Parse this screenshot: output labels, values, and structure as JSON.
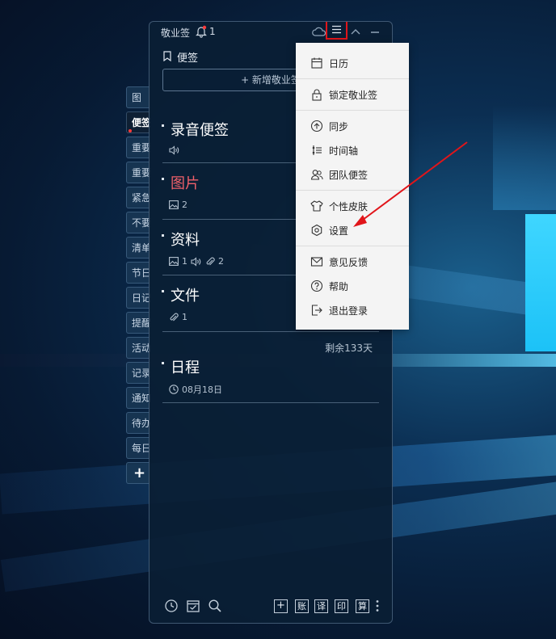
{
  "window": {
    "title": "敬业签",
    "notification_count": "1"
  },
  "section_title": "便签",
  "new_button_label": "+ 新增敬业签",
  "tabs": [
    "图",
    "便签",
    "重要",
    "重要",
    "紧急",
    "不要",
    "清单",
    "节日",
    "日记",
    "提醒",
    "活动",
    "记录",
    "通知",
    "待办",
    "每日"
  ],
  "tab_add_label": "+",
  "notes": [
    {
      "title": "录音便签",
      "audio": true
    },
    {
      "title": "图片",
      "image_count": "2"
    },
    {
      "title": "资料",
      "image_count": "1",
      "attachment_count": "2",
      "audio": true
    },
    {
      "title": "文件",
      "attachment_count": "1"
    },
    {
      "title": "日程",
      "date": "08月18日"
    }
  ],
  "remaining_days": "剩余133天",
  "menu": {
    "items": [
      "日历",
      "锁定敬业签",
      "同步",
      "时间轴",
      "团队便签",
      "个性皮肤",
      "设置",
      "意见反馈",
      "帮助",
      "退出登录"
    ]
  },
  "bottom_toolbar": {
    "buttons": [
      "账",
      "译",
      "印",
      "算"
    ]
  },
  "colors": {
    "highlight": "#e1151a",
    "note_red_title": "#f0606a",
    "menu_bg": "#f4f4f4"
  }
}
